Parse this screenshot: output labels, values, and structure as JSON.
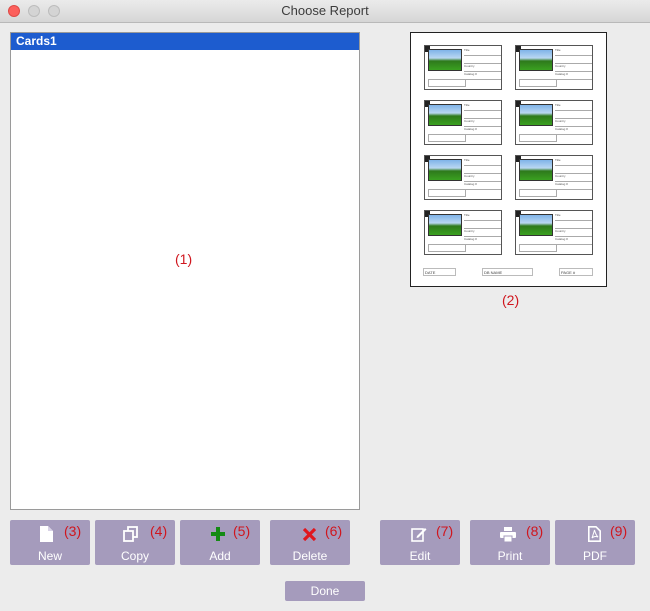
{
  "window": {
    "title": "Choose Report"
  },
  "report_list": {
    "items": [
      {
        "label": "Cards1",
        "selected": true
      }
    ],
    "callout": "(1)"
  },
  "preview": {
    "callout": "(2)",
    "card_fields": [
      "Title",
      "Country",
      "Catalog #",
      "Issued on"
    ],
    "footer": [
      "DATE",
      "DB NAME",
      "PAGE #"
    ]
  },
  "buttons": [
    {
      "label": "New",
      "callout": "(3)",
      "icon": "document-icon"
    },
    {
      "label": "Copy",
      "callout": "(4)",
      "icon": "copy-icon"
    },
    {
      "label": "Add",
      "callout": "(5)",
      "icon": "plus-icon"
    },
    {
      "label": "Delete",
      "callout": "(6)",
      "icon": "x-icon"
    },
    {
      "label": "Edit",
      "callout": "(7)",
      "icon": "edit-icon"
    },
    {
      "label": "Print",
      "callout": "(8)",
      "icon": "printer-icon"
    },
    {
      "label": "PDF",
      "callout": "(9)",
      "icon": "pdf-icon"
    }
  ],
  "done": {
    "label": "Done"
  },
  "colors": {
    "button": "#a59bbc",
    "selection": "#1d5ccf",
    "callout": "#d0161e"
  }
}
